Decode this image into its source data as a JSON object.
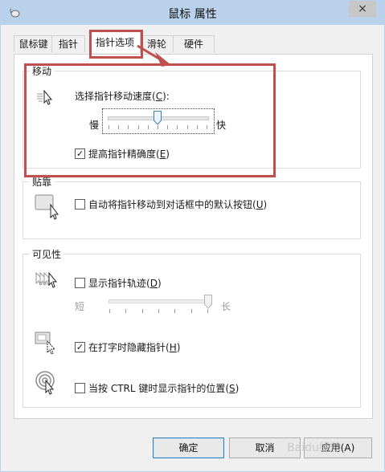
{
  "window": {
    "title": "鼠标 属性",
    "close_glyph": "×"
  },
  "tabs": [
    "鼠标键",
    "指针",
    "指针选项",
    "滑轮",
    "硬件"
  ],
  "motion": {
    "title": "移动",
    "speed_label_prefix": "选择指针移动速度(",
    "speed_label_key": "C",
    "speed_label_suffix": "):",
    "slow_label": "慢",
    "fast_label": "快",
    "speed_level": 0.5,
    "precision_prefix": "提高指针精确度(",
    "precision_key": "E",
    "precision_suffix": ")",
    "precision_checked": true
  },
  "snap": {
    "title": "贴靠",
    "label_prefix": "自动将指针移动到对话框中的默认按钮(",
    "label_key": "U",
    "label_suffix": ")",
    "checked": false
  },
  "visibility": {
    "title": "可见性",
    "trails_prefix": "显示指针轨迹(",
    "trails_key": "D",
    "trails_suffix": ")",
    "trails_checked": false,
    "short_label": "短",
    "long_label": "长",
    "trail_length_level": 1.0,
    "hide_prefix": "在打字时隐藏指针(",
    "hide_key": "H",
    "hide_suffix": ")",
    "hide_checked": true,
    "ctrl_prefix": "当按 CTRL 键时显示指针的位置(",
    "ctrl_key": "S",
    "ctrl_suffix": ")",
    "ctrl_checked": false
  },
  "buttons": {
    "ok": "确定",
    "cancel": "取消",
    "apply": "应用(A)"
  },
  "watermark": "Baidu经验",
  "colors": {
    "annotation": "#c0504d",
    "titlebar": "#b9d1ea",
    "thumb": "#3c7fb1"
  }
}
